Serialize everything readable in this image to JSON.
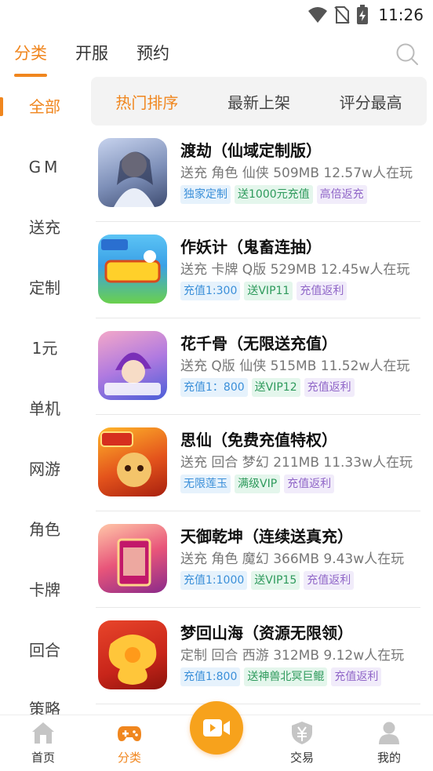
{
  "status_bar": {
    "time": "11:26",
    "icons": [
      "wifi-icon",
      "no-sim-icon",
      "battery-charging-icon"
    ]
  },
  "top_tabs": [
    {
      "label": "分类",
      "active": true
    },
    {
      "label": "开服",
      "active": false
    },
    {
      "label": "预约",
      "active": false
    }
  ],
  "search": {
    "icon": "search-icon"
  },
  "sidebar": {
    "items": [
      {
        "label": "全部",
        "active": true
      },
      {
        "label": "GM",
        "active": false
      },
      {
        "label": "送充",
        "active": false
      },
      {
        "label": "定制",
        "active": false
      },
      {
        "label": "1元",
        "active": false
      },
      {
        "label": "单机",
        "active": false
      },
      {
        "label": "网游",
        "active": false
      },
      {
        "label": "角色",
        "active": false
      },
      {
        "label": "卡牌",
        "active": false
      },
      {
        "label": "回合",
        "active": false
      },
      {
        "label": "策略",
        "active": false
      }
    ]
  },
  "sort_bar": {
    "items": [
      {
        "label": "热门排序",
        "active": true
      },
      {
        "label": "最新上架",
        "active": false
      },
      {
        "label": "评分最高",
        "active": false
      }
    ]
  },
  "games": [
    {
      "title": "渡劫（仙域定制版）",
      "meta": "送充 角色 仙侠   509MB   12.57w人在玩",
      "tags": [
        {
          "text": "独家定制",
          "color": "blue"
        },
        {
          "text": "送1000元充值",
          "color": "green"
        },
        {
          "text": "高倍返充",
          "color": "purple"
        }
      ],
      "icon_colors": [
        "#7d8fb8",
        "#c7d3ee"
      ]
    },
    {
      "title": "作妖计（鬼畜连抽）",
      "meta": "送充 卡牌 Q版   529MB   12.45w人在玩",
      "tags": [
        {
          "text": "充值1:300",
          "color": "blue"
        },
        {
          "text": "送VIP11",
          "color": "green"
        },
        {
          "text": "充值返利",
          "color": "purple"
        }
      ],
      "icon_colors": [
        "#3aa0e6",
        "#ffd02a"
      ]
    },
    {
      "title": "花千骨（无限送充值）",
      "meta": "送充 Q版 仙侠   515MB   11.52w人在玩",
      "tags": [
        {
          "text": "充值1：800",
          "color": "blue"
        },
        {
          "text": "送VIP12",
          "color": "green"
        },
        {
          "text": "充值返利",
          "color": "purple"
        }
      ],
      "icon_colors": [
        "#8b4fd1",
        "#f4a8c8"
      ]
    },
    {
      "title": "思仙（免费充值特权）",
      "meta": "送充 回合 梦幻   211MB   11.33w人在玩",
      "tags": [
        {
          "text": "无限莲玉",
          "color": "blue"
        },
        {
          "text": "满级VIP",
          "color": "green"
        },
        {
          "text": "充值返利",
          "color": "purple"
        }
      ],
      "icon_colors": [
        "#d62f1f",
        "#ffb62a"
      ]
    },
    {
      "title": "天御乾坤（连续送真充）",
      "meta": "送充 角色 魔幻   366MB   9.43w人在玩",
      "tags": [
        {
          "text": "充值1:1000",
          "color": "blue"
        },
        {
          "text": "送VIP15",
          "color": "green"
        },
        {
          "text": "充值返利",
          "color": "purple"
        }
      ],
      "icon_colors": [
        "#e8557a",
        "#ffc7a8"
      ]
    },
    {
      "title": "梦回山海（资源无限领）",
      "meta": "定制 回合 西游   312MB   9.12w人在玩",
      "tags": [
        {
          "text": "充值1:800",
          "color": "blue"
        },
        {
          "text": "送神兽北冥巨鲲",
          "color": "green"
        },
        {
          "text": "充值返利",
          "color": "purple"
        }
      ],
      "icon_colors": [
        "#d8341c",
        "#ffc63a"
      ]
    }
  ],
  "bottom_nav": {
    "items": [
      {
        "label": "首页",
        "icon": "home-icon",
        "active": false
      },
      {
        "label": "分类",
        "icon": "gamepad-icon",
        "active": true
      },
      {
        "label": "",
        "icon": "video-icon",
        "active": false
      },
      {
        "label": "交易",
        "icon": "trade-shield-icon",
        "active": false
      },
      {
        "label": "我的",
        "icon": "user-icon",
        "active": false
      }
    ]
  },
  "colors": {
    "accent": "#f0861e",
    "center_button": "#f7a21c"
  }
}
